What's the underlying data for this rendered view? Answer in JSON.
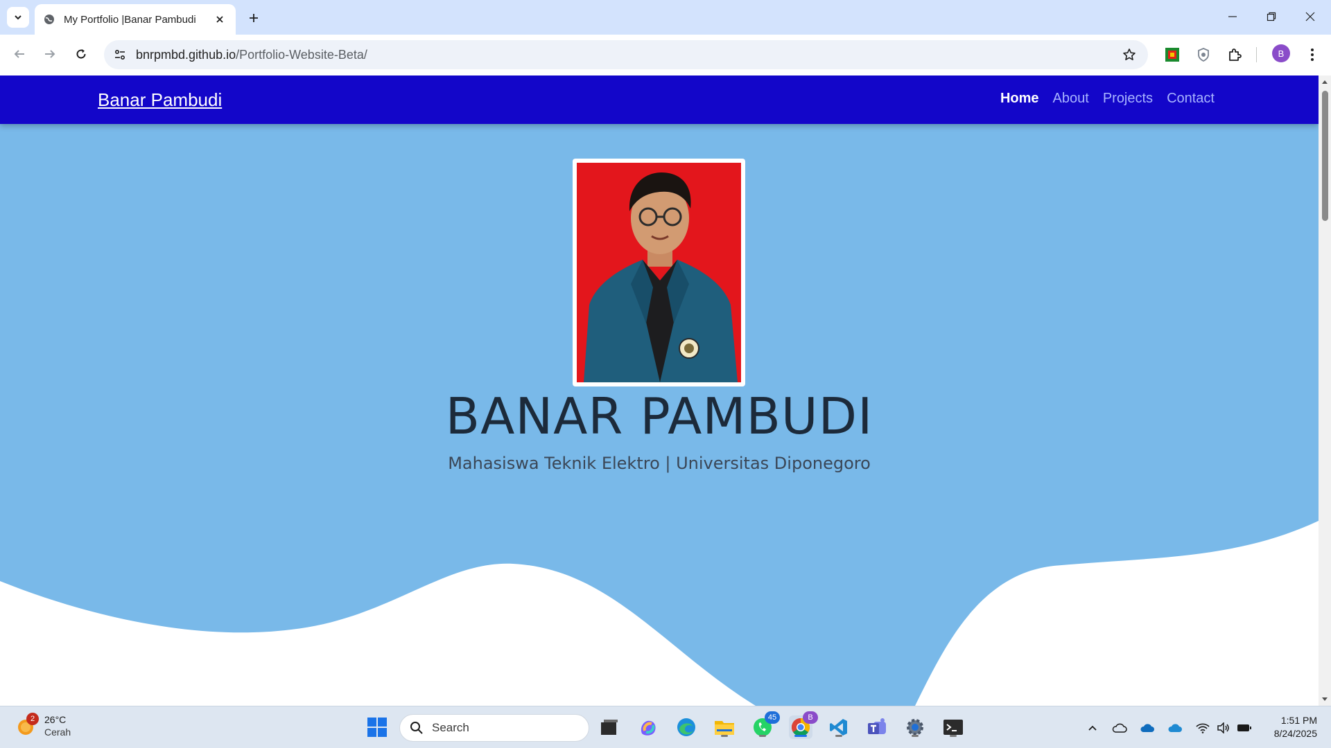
{
  "browser": {
    "tab_title": "My Portfolio |Banar Pambudi",
    "url_host": "bnrpmbd.github.io",
    "url_path": "/Portfolio-Website-Beta/",
    "profile_initial": "B"
  },
  "site": {
    "brand": "Banar Pambudi",
    "nav": [
      {
        "label": "Home",
        "active": true
      },
      {
        "label": "About",
        "active": false
      },
      {
        "label": "Projects",
        "active": false
      },
      {
        "label": "Contact",
        "active": false
      }
    ],
    "hero_name": "BANAR PAMBUDI",
    "hero_subtitle": "Mahasiswa Teknik Elektro | Universitas Diponegoro",
    "colors": {
      "nav_bg": "#1306c9",
      "hero_bg": "#79b9e9",
      "photo_bg": "#e3161c"
    }
  },
  "taskbar": {
    "weather_badge": "2",
    "weather_temp": "26°C",
    "weather_cond": "Cerah",
    "search_label": "Search",
    "whatsapp_badge": "45",
    "chrome_badge": "B",
    "time": "1:51 PM",
    "date": "8/24/2025"
  }
}
